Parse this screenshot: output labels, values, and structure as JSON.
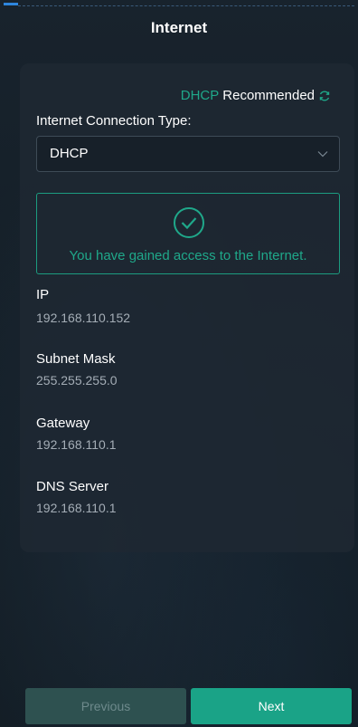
{
  "header": {
    "title": "Internet"
  },
  "recommendation": {
    "type": "DHCP",
    "label": "Recommended",
    "icon": "refresh-icon"
  },
  "connection_type": {
    "label": "Internet Connection Type:",
    "value": "DHCP"
  },
  "status": {
    "icon": "check-circle-icon",
    "message": "You have gained access to the Internet."
  },
  "fields": [
    {
      "label": "IP",
      "value": "192.168.110.152"
    },
    {
      "label": "Subnet Mask",
      "value": "255.255.255.0"
    },
    {
      "label": "Gateway",
      "value": "192.168.110.1"
    },
    {
      "label": "DNS Server",
      "value": "192.168.110.1"
    }
  ],
  "footer": {
    "previous_label": "Previous",
    "next_label": "Next"
  },
  "colors": {
    "accent": "#1fa88a",
    "background": "#131d25"
  }
}
